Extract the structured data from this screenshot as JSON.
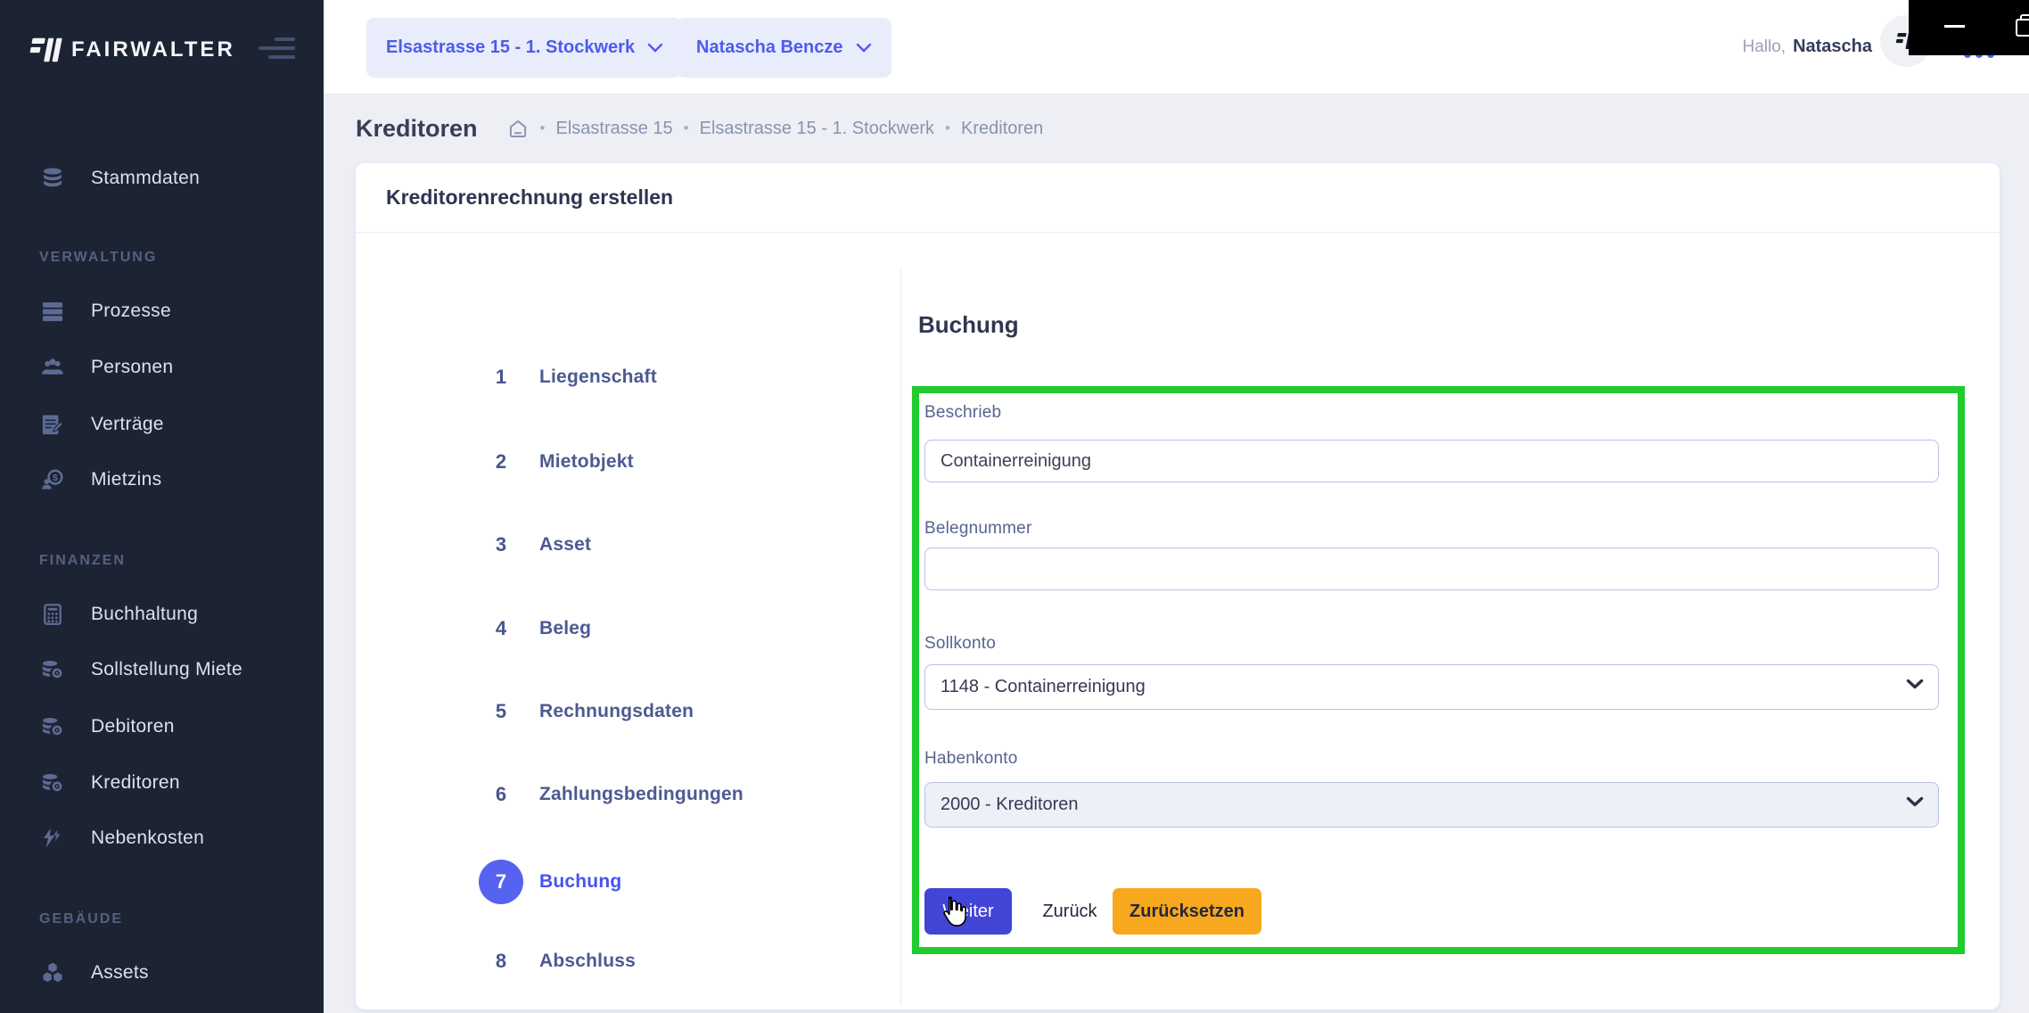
{
  "app": {
    "brand": "FAIRWALTER",
    "greeting_prefix": "Hallo,",
    "greeting_name": "Natascha"
  },
  "topbar": {
    "property_selector": "Elsastrasse 15 - 1. Stockwerk",
    "person_selector": "Natascha Bencze"
  },
  "sidebar": {
    "entries": [
      {
        "type": "item",
        "label": "Stammdaten",
        "icon": "database-icon"
      },
      {
        "type": "header",
        "label": "VERWALTUNG"
      },
      {
        "type": "item",
        "label": "Prozesse",
        "icon": "process-list-icon"
      },
      {
        "type": "item",
        "label": "Personen",
        "icon": "people-icon"
      },
      {
        "type": "item",
        "label": "Verträge",
        "icon": "contract-icon"
      },
      {
        "type": "item",
        "label": "Mietzins",
        "icon": "rent-coin-icon"
      },
      {
        "type": "header",
        "label": "FINANZEN"
      },
      {
        "type": "item",
        "label": "Buchhaltung",
        "icon": "calculator-icon"
      },
      {
        "type": "item",
        "label": "Sollstellung Miete",
        "icon": "coins-icon"
      },
      {
        "type": "item",
        "label": "Debitoren",
        "icon": "coins-icon"
      },
      {
        "type": "item",
        "label": "Kreditoren",
        "icon": "coins-icon"
      },
      {
        "type": "item",
        "label": "Nebenkosten",
        "icon": "bolt-icon"
      },
      {
        "type": "header",
        "label": "GEBÄUDE"
      },
      {
        "type": "item",
        "label": "Assets",
        "icon": "cubes-icon"
      }
    ]
  },
  "breadcrumb": {
    "page_title": "Kreditoren",
    "separator": "•",
    "crumbs": [
      "Elsastrasse 15",
      "Elsastrasse 15 - 1. Stockwerk",
      "Kreditoren"
    ]
  },
  "wizard": {
    "card_title": "Kreditorenrechnung erstellen",
    "active_step": 7,
    "steps": [
      {
        "num": "1",
        "label": "Liegenschaft"
      },
      {
        "num": "2",
        "label": "Mietobjekt"
      },
      {
        "num": "3",
        "label": "Asset"
      },
      {
        "num": "4",
        "label": "Beleg"
      },
      {
        "num": "5",
        "label": "Rechnungsdaten"
      },
      {
        "num": "6",
        "label": "Zahlungsbedingungen"
      },
      {
        "num": "7",
        "label": "Buchung"
      },
      {
        "num": "8",
        "label": "Abschluss"
      }
    ]
  },
  "form": {
    "heading": "Buchung",
    "beschrieb": {
      "label": "Beschrieb",
      "value": "Containerreinigung"
    },
    "belegnummer": {
      "label": "Belegnummer",
      "value": ""
    },
    "sollkonto": {
      "label": "Sollkonto",
      "value": "1148 - Containerreinigung"
    },
    "habenkonto": {
      "label": "Habenkonto",
      "value": "2000 - Kreditoren"
    },
    "buttons": {
      "next": "Weiter",
      "back": "Zurück",
      "reset": "Zurücksetzen"
    }
  },
  "colors": {
    "sidebar_bg": "#1c2332",
    "accent": "#4c5ced",
    "active_step": "#5663f0",
    "primary_button": "#4245d6",
    "warning_button": "#f8a81e",
    "annotation_green": "#1fcb2f"
  }
}
